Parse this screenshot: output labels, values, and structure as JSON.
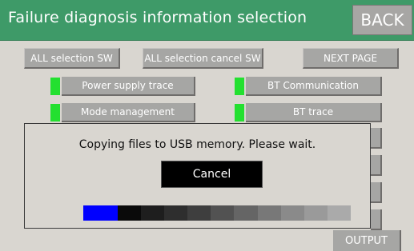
{
  "header": {
    "title": "Failure diagnosis information selection",
    "back_label": "BACK"
  },
  "toolbar": {
    "all_selection": "ALL selection SW",
    "all_selection_cancel": "ALL selection cancel SW",
    "next_page": "NEXT PAGE"
  },
  "items": [
    {
      "label": "Power supply trace",
      "selected": true
    },
    {
      "label": "BT Communication",
      "selected": true
    },
    {
      "label": "Mode management",
      "selected": true
    },
    {
      "label": "BT trace",
      "selected": true
    }
  ],
  "dialog": {
    "message": "Copying files to USB memory. Please wait.",
    "cancel_label": "Cancel",
    "progress_fraction": 0.13,
    "active_color": "#0000ff"
  },
  "footer": {
    "output_label": "OUTPUT"
  },
  "colors": {
    "header": "#3e9a68",
    "indicator": "#23e030",
    "button": "#a6a6a4",
    "background": "#d9d6d0"
  }
}
